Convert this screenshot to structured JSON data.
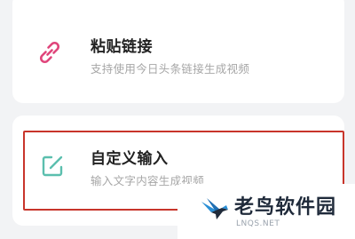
{
  "options": {
    "paste_link": {
      "title": "粘贴链接",
      "subtitle": "支持使用今日头条链接生成视频",
      "icon": "link-icon",
      "icon_color": "#e0457b"
    },
    "custom_input": {
      "title": "自定义输入",
      "subtitle": "输入文字内容生成视频",
      "icon": "edit-icon",
      "icon_color": "#5bbfae"
    }
  },
  "highlight": {
    "color": "#c8352b"
  },
  "watermark": {
    "title": "老鸟软件园",
    "url": "LNQS.NET",
    "icon": "bird-logo-icon"
  }
}
